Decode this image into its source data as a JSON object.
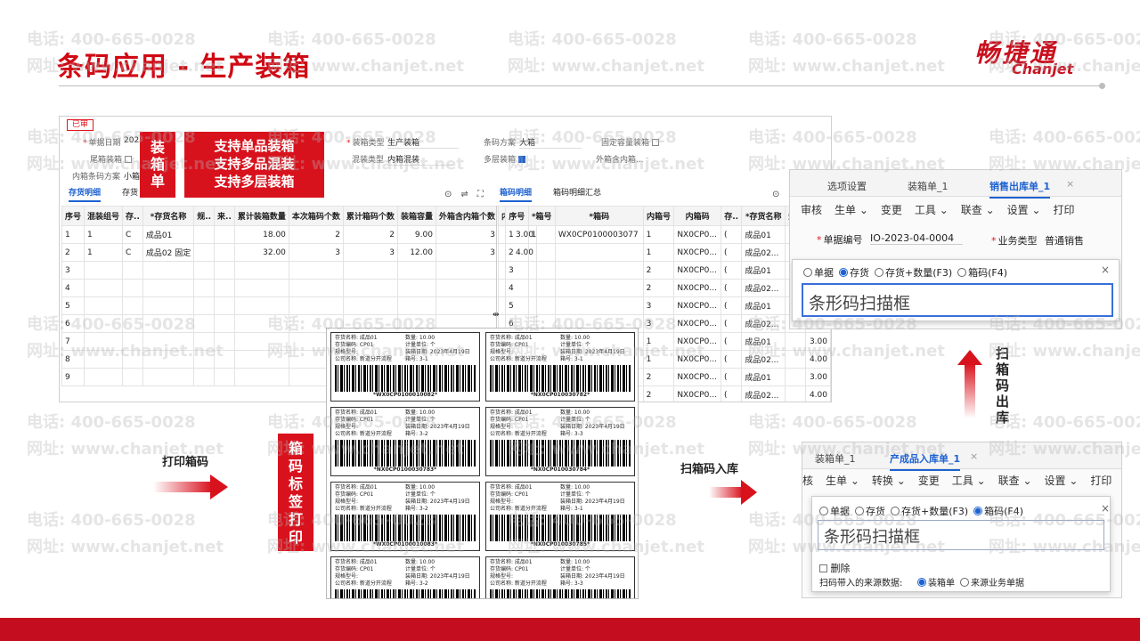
{
  "slide": {
    "title": "条码应用 - 生产装箱",
    "logo_cn": "畅捷通",
    "logo_en": "Chanjet",
    "watermark_phone": "电话: 400-665-0028",
    "watermark_web": "网址: www.chanjet.net"
  },
  "callouts": {
    "box_vertical": "装\n箱\n单",
    "features": [
      "支持单品装箱",
      "支持多品混装",
      "支持多层装箱"
    ],
    "print_vertical": "箱\n码\n标\n签\n打\n印",
    "scan_out_vertical": "扫\n箱\n码\n出\n库"
  },
  "arrows": {
    "print_box_code": "打印箱码",
    "scan_in": "扫箱码入库"
  },
  "box_form": {
    "status_badge": "已审",
    "date_label": "单据日期",
    "date_value": "2023",
    "tail_box_label": "尾箱装箱",
    "inner_box_scheme_label": "内箱条码方案",
    "inner_box_scheme_value": "小箱",
    "box_type_label": "装箱类型",
    "box_type_value": "生产装箱",
    "mix_type_label": "混装类型",
    "mix_type_value": "内箱混装",
    "barcode_scheme_label": "条码方案",
    "barcode_scheme_value": "大箱",
    "multi_layer_label": "多层装箱",
    "fixed_qty_label": "固定容量装箱",
    "outer_inner_label": "外箱含内箱...",
    "tab_inventory": "存货明细",
    "tab_inventory2": "存货",
    "tab_boxcode": "箱码明细",
    "tab_boxcode_summary": "箱码明细汇总",
    "left_headers": [
      "序号",
      "混装组号",
      "存..",
      "*存货名称",
      "规..",
      "来..",
      "累计装箱数量",
      "本次箱码个数",
      "累计箱码个数",
      "装箱容量",
      "外箱含内箱个数",
      "内箱容量"
    ],
    "left_rows": [
      [
        "1",
        "1",
        "C",
        "成品01",
        "",
        "",
        "18.00",
        "2",
        "2",
        "9.00",
        "3",
        "3.00"
      ],
      [
        "2",
        "1",
        "C",
        "成品02 固定",
        "",
        "",
        "32.00",
        "3",
        "3",
        "12.00",
        "3",
        "4.00"
      ],
      [
        "3"
      ],
      [
        "4"
      ],
      [
        "5"
      ],
      [
        "6"
      ],
      [
        "7"
      ],
      [
        "8"
      ],
      [
        "9"
      ]
    ],
    "right_headers": [
      "序号",
      "*箱号",
      "*箱码",
      "内箱号",
      "内箱码",
      "存..",
      "*存货名称",
      "规..",
      "..."
    ],
    "right_rows": [
      [
        "1",
        "1",
        "WX0CP0100003077",
        "1",
        "NX0CP0...",
        "(",
        "成品01",
        "",
        "3.00"
      ],
      [
        "2",
        "",
        "",
        "1",
        "NX0CP0...",
        "(",
        "成品02...",
        "",
        "4.00"
      ],
      [
        "3",
        "",
        "",
        "2",
        "NX0CP0...",
        "(",
        "成品01",
        "",
        "3.00"
      ],
      [
        "4",
        "",
        "",
        "2",
        "NX0CP0...",
        "(",
        "成品02...",
        "",
        "4.00"
      ],
      [
        "5",
        "",
        "",
        "3",
        "NX0CP0...",
        "(",
        "成品01",
        "",
        "3.00"
      ],
      [
        "6",
        "",
        "",
        "3",
        "NX0CP0...",
        "(",
        "成品02...",
        "",
        "4.00"
      ],
      [
        "7",
        "",
        "",
        "1",
        "NX0CP0...",
        "(",
        "成品01",
        "",
        "3.00"
      ],
      [
        "8",
        "",
        "",
        "1",
        "NX0CP0...",
        "(",
        "成品02...",
        "",
        "4.00"
      ],
      [
        "9",
        "",
        "",
        "2",
        "NX0CP0...",
        "(",
        "成品01",
        "",
        "3.00"
      ],
      [
        "10",
        "",
        "",
        "2",
        "NX0CP0...",
        "(",
        "成品02...",
        "",
        "4.00"
      ]
    ]
  },
  "labels": {
    "item_name_label": "存货名称:",
    "item_code_label": "存货编码:",
    "spec_label": "规格型号:",
    "company_label": "公司名称:",
    "qty_label": "数量:",
    "unit_label": "计量单位:",
    "box_date_label": "装箱日期:",
    "box_no_label": "箱号:",
    "cards": [
      {
        "name": "成品01",
        "code": "CP01",
        "qty": "10.00",
        "unit": "个",
        "date": "2023年4月19日",
        "company": "新道分开流程",
        "box": "3-1",
        "barcode": "*WX0CP0100010082*"
      },
      {
        "name": "成品01",
        "code": "CP01",
        "qty": "10.00",
        "unit": "个",
        "date": "2023年4月19日",
        "company": "新道分开流程",
        "box": "3-1",
        "barcode": "*NX0CP010030782*"
      },
      {
        "name": "成品01",
        "code": "CP01",
        "qty": "10.00",
        "unit": "个",
        "date": "2023年4月19日",
        "company": "新道分开流程",
        "box": "3-2",
        "barcode": "*NX0CP0100030783*"
      },
      {
        "name": "成品01",
        "code": "CP01",
        "qty": "10.00",
        "unit": "个",
        "date": "2023年4月19日",
        "company": "新道分开流程",
        "box": "3-3",
        "barcode": "*NX0CP010030784*"
      },
      {
        "name": "成品01",
        "code": "CP01",
        "qty": "10.00",
        "unit": "个",
        "date": "2023年4月19日",
        "company": "新道分开流程",
        "box": "3-2",
        "barcode": "*WX0CP0100010083*"
      },
      {
        "name": "成品01",
        "code": "CP01",
        "qty": "10.00",
        "unit": "个",
        "date": "2023年4月19日",
        "company": "新道分开流程",
        "box": "3-1",
        "barcode": "*NX0CP010030785*"
      },
      {
        "name": "成品01",
        "code": "CP01",
        "qty": "10.00",
        "unit": "个",
        "date": "2023年4月19日",
        "company": "新道分开流程",
        "box": "3-2",
        "barcode": ""
      },
      {
        "name": "成品01",
        "code": "CP01",
        "qty": "10.00",
        "unit": "个",
        "date": "2023年4月19日",
        "company": "新道分开流程",
        "box": "3-3",
        "barcode": ""
      }
    ]
  },
  "sales_out": {
    "tabs": [
      "选项设置",
      "装箱单_1",
      "销售出库单_1"
    ],
    "close": "×",
    "toolbar": [
      "审核",
      "生单",
      "变更",
      "工具",
      "联查",
      "设置",
      "打印"
    ],
    "doc_no_label": "单据编号",
    "doc_no_value": "IO-2023-04-0004",
    "biz_type_label": "业务类型",
    "biz_type_value": "普通销售",
    "radios": [
      "单据",
      "存货",
      "存货+数量(F3)",
      "箱码(F4)"
    ],
    "scan_placeholder": "条形码扫描框"
  },
  "product_in": {
    "tabs": [
      "装箱单_1",
      "产成品入库单_1"
    ],
    "close": "×",
    "toolbar": [
      "核",
      "生单",
      "转换",
      "变更",
      "工具",
      "联查",
      "设置",
      "打印"
    ],
    "radios": [
      "单据",
      "存货",
      "存货+数量(F3)",
      "箱码(F4)"
    ],
    "scan_placeholder": "条形码扫描框",
    "delete_label": "删除",
    "source_label": "扫码带入的来源数据:",
    "source_opts": [
      "装箱单",
      "来源业务单据"
    ]
  }
}
